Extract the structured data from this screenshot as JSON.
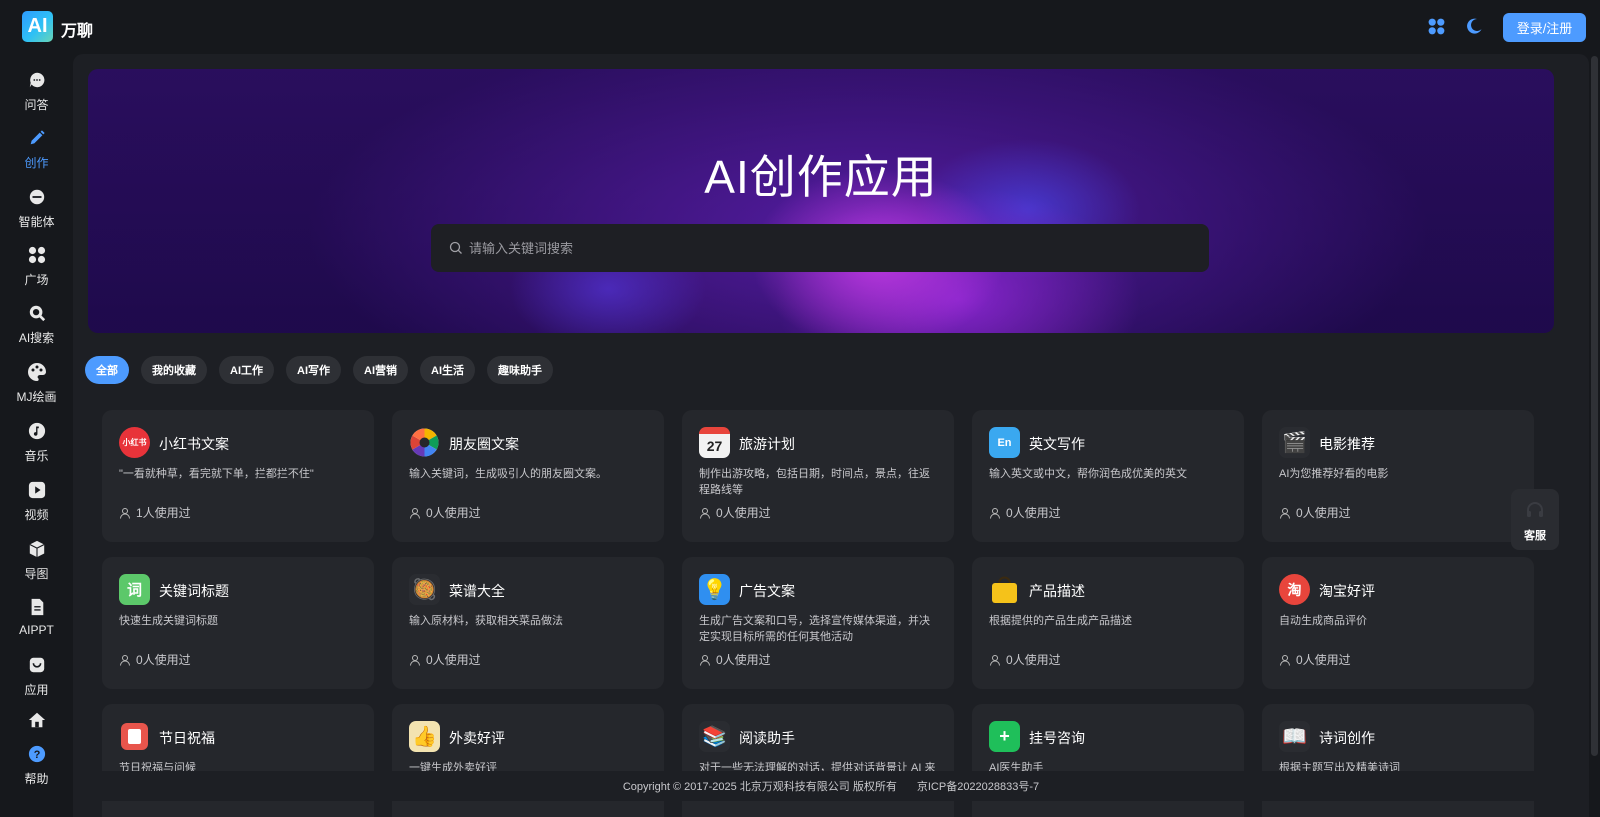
{
  "app": {
    "logo_text": "AI",
    "brand": "万聊",
    "login_label": "登录/注册"
  },
  "sidebar": {
    "items": [
      {
        "label": "问答",
        "icon": "chat-icon"
      },
      {
        "label": "创作",
        "icon": "pen-icon",
        "active": true
      },
      {
        "label": "智能体",
        "icon": "agent-icon"
      },
      {
        "label": "广场",
        "icon": "grid-icon"
      },
      {
        "label": "AI搜索",
        "icon": "search-icon"
      },
      {
        "label": "MJ绘画",
        "icon": "palette-icon"
      },
      {
        "label": "音乐",
        "icon": "music-icon"
      },
      {
        "label": "视频",
        "icon": "play-icon"
      },
      {
        "label": "导图",
        "icon": "cube-icon"
      },
      {
        "label": "AIPPT",
        "icon": "doc-icon"
      },
      {
        "label": "应用",
        "icon": "bag-icon"
      },
      {
        "label": "",
        "icon": "home-icon"
      },
      {
        "label": "帮助",
        "icon": "help-icon"
      }
    ]
  },
  "hero": {
    "title": "AI创作应用",
    "search_placeholder": "请输入关键词搜索"
  },
  "tabs": [
    "全部",
    "我的收藏",
    "AI工作",
    "AI写作",
    "AI营销",
    "AI生活",
    "趣味助手"
  ],
  "cards": [
    {
      "title": "小红书文案",
      "desc": "\"一看就种草，看完就下单，拦都拦不住\"",
      "usage": "1人使用过",
      "icon": "xiaohongshu-icon",
      "color": "#e8333a",
      "glyph": "小红书"
    },
    {
      "title": "朋友圈文案",
      "desc": "输入关键词，生成吸引人的朋友圈文案。",
      "usage": "0人使用过",
      "icon": "aperture-icon",
      "color": "#2a2c31",
      "glyph": ""
    },
    {
      "title": "旅游计划",
      "desc": "制作出游攻略，包括日期，时间点，景点，往返程路线等",
      "usage": "0人使用过",
      "icon": "calendar-icon",
      "color": "#f2f2f2",
      "glyph": "27"
    },
    {
      "title": "英文写作",
      "desc": "输入英文或中文，帮你润色成优美的英文",
      "usage": "0人使用过",
      "icon": "english-icon",
      "color": "#3aa8f0",
      "glyph": "En"
    },
    {
      "title": "电影推荐",
      "desc": "AI为您推荐好看的电影",
      "usage": "0人使用过",
      "icon": "clapper-icon",
      "color": "#2a2c31",
      "glyph": "🎬"
    },
    {
      "title": "关键词标题",
      "desc": "快速生成关键词标题",
      "usage": "0人使用过",
      "icon": "keyword-icon",
      "color": "#5cc86a",
      "glyph": "词"
    },
    {
      "title": "菜谱大全",
      "desc": "输入原材料，获取相关菜品做法",
      "usage": "0人使用过",
      "icon": "dish-icon",
      "color": "#2a2c31",
      "glyph": "🥘"
    },
    {
      "title": "广告文案",
      "desc": "生成广告文案和口号，选择宣传媒体渠道，并决定实现目标所需的任何其他活动",
      "usage": "0人使用过",
      "icon": "bulb-icon",
      "color": "#2f8ff0",
      "glyph": "💡"
    },
    {
      "title": "产品描述",
      "desc": "根据提供的产品生成产品描述",
      "usage": "0人使用过",
      "icon": "shopping-bag-icon",
      "color": "#f5c21a",
      "glyph": ""
    },
    {
      "title": "淘宝好评",
      "desc": "自动生成商品评价",
      "usage": "0人使用过",
      "icon": "taobao-icon",
      "color": "#e8453c",
      "glyph": "淘"
    },
    {
      "title": "节日祝福",
      "desc": "节日祝福与问候",
      "usage": "",
      "icon": "festival-icon",
      "color": "#e8554c",
      "glyph": ""
    },
    {
      "title": "外卖好评",
      "desc": "一键生成外卖好评",
      "usage": "",
      "icon": "thumbs-up-icon",
      "color": "#f3e3b0",
      "glyph": "👍"
    },
    {
      "title": "阅读助手",
      "desc": "对于一些无法理解的对话，提供对话背景让 AI 来",
      "usage": "",
      "icon": "books-icon",
      "color": "#2a2c31",
      "glyph": "📚"
    },
    {
      "title": "挂号咨询",
      "desc": "AI医生助手",
      "usage": "",
      "icon": "hospital-icon",
      "color": "#1fbf5a",
      "glyph": "+"
    },
    {
      "title": "诗词创作",
      "desc": "根据主题写出及精美诗词",
      "usage": "",
      "icon": "open-book-icon",
      "color": "#2a2c31",
      "glyph": "📖"
    }
  ],
  "footer": {
    "copyright": "Copyright © 2017-2025 北京万观科技有限公司 版权所有",
    "icp": "京ICP备2022028833号-7"
  },
  "service": {
    "label": "客服"
  }
}
